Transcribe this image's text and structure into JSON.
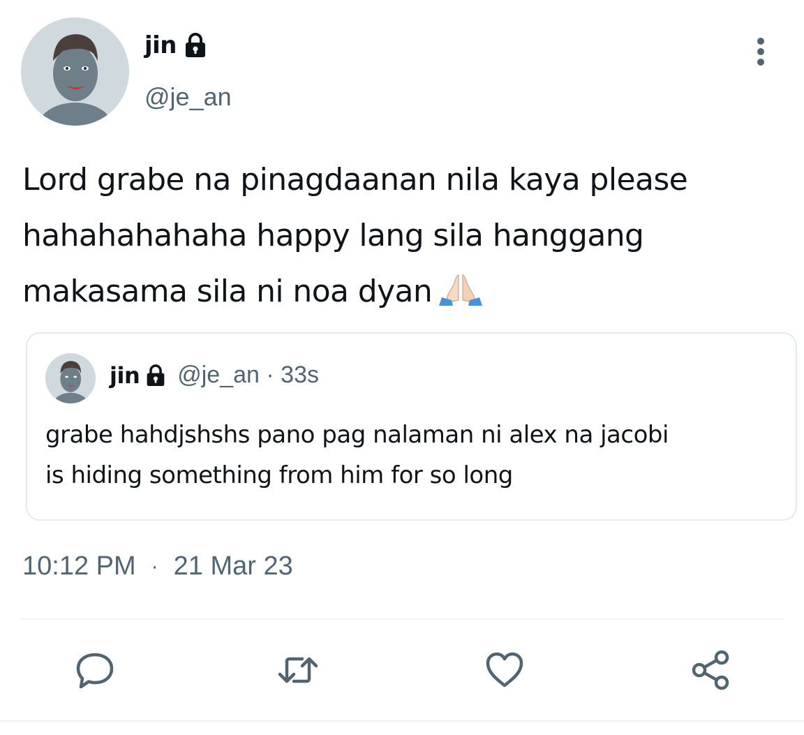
{
  "tweet": {
    "author": {
      "display_name": "jin",
      "handle": "@je_an",
      "protected": true
    },
    "text_lines": [
      "Lord grabe na pinagdaanan nila kaya please",
      "hahahahahaha happy lang sila hanggang",
      "makasama sila ni noa dyan"
    ],
    "emoji": "folded-hands",
    "timestamp": {
      "time": "10:12 PM",
      "separator": "·",
      "date": "21 Mar 23"
    }
  },
  "quote": {
    "display_name": "jin",
    "handle": "@je_an",
    "separator": "·",
    "age": "33s",
    "text_lines": [
      "grabe hahdjshshs pano pag nalaman ni alex na jacobi",
      "is hiding something from him for so long"
    ]
  },
  "actions": [
    "reply-icon",
    "retweet-icon",
    "like-icon",
    "share-icon"
  ],
  "colors": {
    "text": "#0f1419",
    "secondary": "#536471",
    "border": "#e5eaee",
    "icon": "#536471",
    "avatar_bg": "#cfd9de",
    "avatar_figure": "#6e7f8a"
  }
}
